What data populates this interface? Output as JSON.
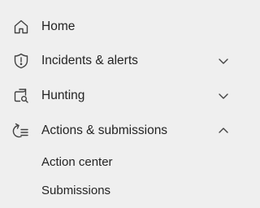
{
  "nav": {
    "items": [
      {
        "label": "Home",
        "icon": "home-icon"
      },
      {
        "label": "Incidents & alerts",
        "icon": "shield-icon",
        "chevron": "chevron-down-icon",
        "expanded": false
      },
      {
        "label": "Hunting",
        "icon": "hunting-icon",
        "chevron": "chevron-down-icon",
        "expanded": false
      },
      {
        "label": "Actions & submissions",
        "icon": "actions-icon",
        "chevron": "chevron-up-icon",
        "expanded": true,
        "children": [
          {
            "label": "Action center"
          },
          {
            "label": "Submissions"
          }
        ]
      }
    ]
  },
  "colors": {
    "background": "#efefef",
    "text": "#242424",
    "icon": "#424242"
  }
}
